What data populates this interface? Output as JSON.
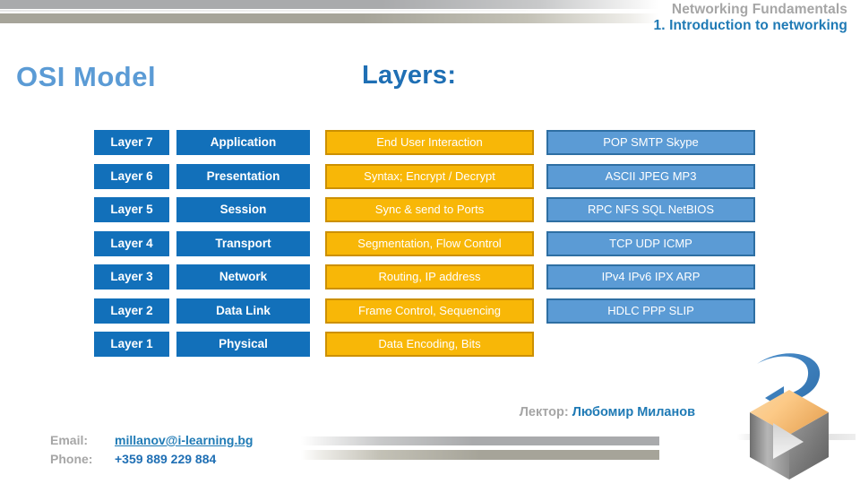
{
  "header": {
    "course": "Networking Fundamentals",
    "lesson": "1. Introduction to networking"
  },
  "titles": {
    "left": "OSI Model",
    "right": "Layers:"
  },
  "table": {
    "rows": [
      {
        "number": "Layer 7",
        "name": "Application",
        "function": "End User Interaction",
        "protocols": "POP SMTP Skype"
      },
      {
        "number": "Layer 6",
        "name": "Presentation",
        "function": "Syntax; Encrypt / Decrypt",
        "protocols": "ASCII JPEG MP3"
      },
      {
        "number": "Layer 5",
        "name": "Session",
        "function": "Sync & send to Ports",
        "protocols": "RPC NFS SQL NetBIOS"
      },
      {
        "number": "Layer 4",
        "name": "Transport",
        "function": "Segmentation, Flow Control",
        "protocols": "TCP UDP ICMP"
      },
      {
        "number": "Layer 3",
        "name": "Network",
        "function": "Routing, IP address",
        "protocols": "IPv4 IPv6 IPX ARP"
      },
      {
        "number": "Layer 2",
        "name": "Data Link",
        "function": "Frame Control, Sequencing",
        "protocols": "HDLC PPP SLIP"
      },
      {
        "number": "Layer 1",
        "name": "Physical",
        "function": "Data Encoding, Bits",
        "protocols": ""
      }
    ]
  },
  "lecturer": {
    "label": "Лектор:",
    "name": "Любомир Миланов"
  },
  "contact": {
    "email_label": "Email:",
    "email_value": "millanov@i-learning.bg",
    "phone_label": "Phone:",
    "phone_value": "+359 889 229 884"
  },
  "logo": {
    "name": "i-learning-cube-logo",
    "arrow_color": "#3a7fc1",
    "top_face_color": "#f8c88a",
    "side_face_color": "#9e9e9e"
  },
  "colors": {
    "layer_blue": "#1270ba",
    "function_gold": "#f8b707",
    "function_gold_border": "#cc9000",
    "protocol_blue": "#5b9bd5",
    "protocol_blue_border": "#2e6fa3",
    "title_light_blue": "#5b9bd5",
    "title_dark_blue": "#1f6fb4",
    "muted_gray": "#a6a6a6"
  }
}
